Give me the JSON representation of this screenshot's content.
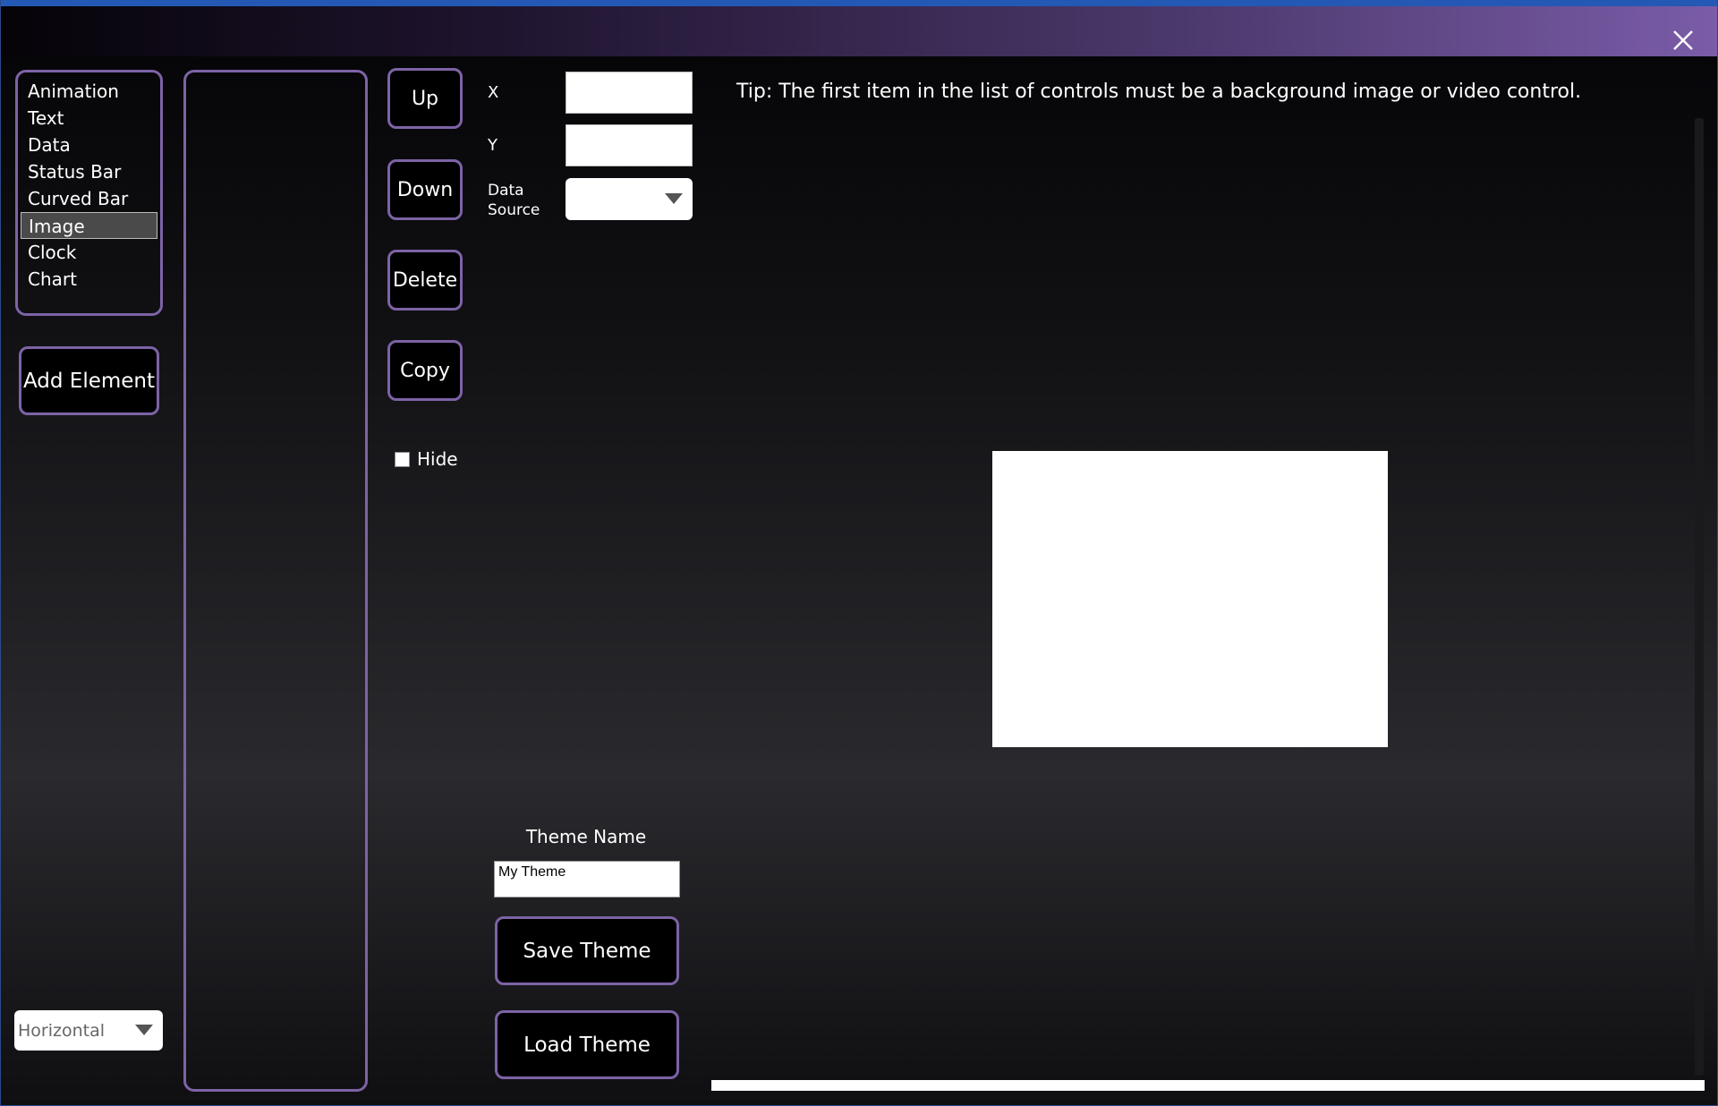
{
  "window": {
    "close_icon": "close-icon"
  },
  "element_types": {
    "items": [
      "Animation",
      "Text",
      "Data",
      "Status Bar",
      "Curved Bar",
      "Image",
      "Clock",
      "Chart"
    ],
    "selected": "Image"
  },
  "buttons": {
    "add_element": "Add Element",
    "up": "Up",
    "down": "Down",
    "delete": "Delete",
    "copy": "Copy",
    "save_theme": "Save Theme",
    "load_theme": "Load Theme"
  },
  "hide": {
    "label": "Hide",
    "checked": false
  },
  "properties": {
    "x_label": "X",
    "x_value": "",
    "y_label": "Y",
    "y_value": "",
    "data_source_label": "Data Source",
    "data_source_value": ""
  },
  "orientation": {
    "value": "Horizontal"
  },
  "tip": "Tip: The first item in the list of controls must be a background image or video control.",
  "theme": {
    "label": "Theme Name",
    "value": "My Theme"
  },
  "colors": {
    "accent_border": "#7d63a6",
    "title_blue": "#2359b5",
    "title_purple": "#7a5ca8"
  }
}
